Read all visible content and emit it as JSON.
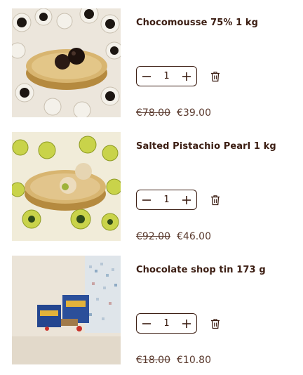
{
  "cart": {
    "items": [
      {
        "title": "Chocomousse 75% 1 kg",
        "quantity": "1",
        "old_price": "€78.00",
        "new_price": "€39.00",
        "image_icon": "chocolate-truffles-gold-plate-image"
      },
      {
        "title": "Salted Pistachio Pearl 1 kg",
        "quantity": "1",
        "old_price": "€92.00",
        "new_price": "€46.00",
        "image_icon": "pistachio-pralines-gold-plate-image"
      },
      {
        "title": "Chocolate shop tin 173 g",
        "quantity": "1",
        "old_price": "€18.00",
        "new_price": "€10.80",
        "image_icon": "chocolate-shop-tin-image"
      }
    ]
  },
  "colors": {
    "text": "#3b1d12",
    "price": "#5a3a2e",
    "gold": "#c9a25a"
  }
}
